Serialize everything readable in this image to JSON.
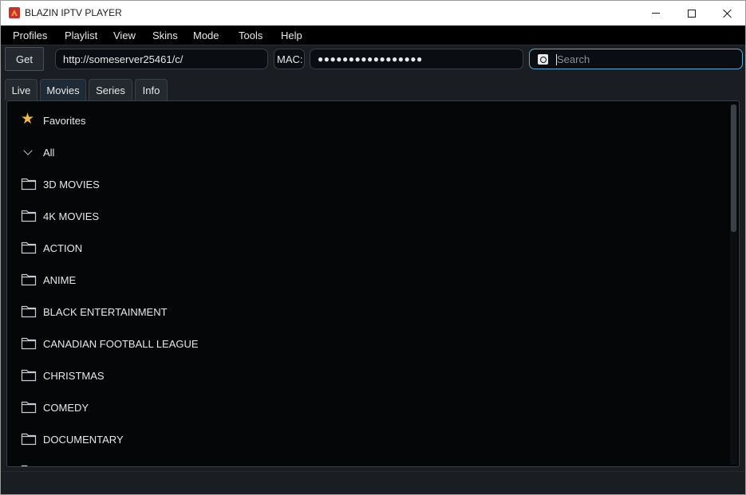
{
  "window": {
    "title": "BLAZIN IPTV PLAYER"
  },
  "menu": [
    "Profiles",
    "Playlist",
    "View",
    "Skins",
    "Mode",
    "Tools",
    "Help"
  ],
  "toolbar": {
    "get_label": "Get",
    "url_value": "http://someserver25461/c/",
    "mac_label": "MAC:",
    "mac_value": "●●●●●●●●●●●●●●●●●",
    "search_placeholder": "Search"
  },
  "tabs": [
    "Live",
    "Movies",
    "Series",
    "Info"
  ],
  "active_tab": "Movies",
  "tree": {
    "favorites": "Favorites",
    "all": "All",
    "categories": [
      "3D MOVIES",
      "4K MOVIES",
      "ACTION",
      "ANIME",
      "BLACK ENTERTAINMENT",
      "CANADIAN FOOTBALL LEAGUE",
      "CHRISTMAS",
      "COMEDY",
      "DOCUMENTARY"
    ]
  },
  "icons": {
    "app": "app-icon",
    "favorites": "star-icon",
    "all": "chevron-down-icon",
    "category": "folder-icon",
    "search": "search-icon"
  },
  "colors": {
    "accent": "#5fa8d3",
    "star": "#f5b841",
    "background": "#050608"
  }
}
